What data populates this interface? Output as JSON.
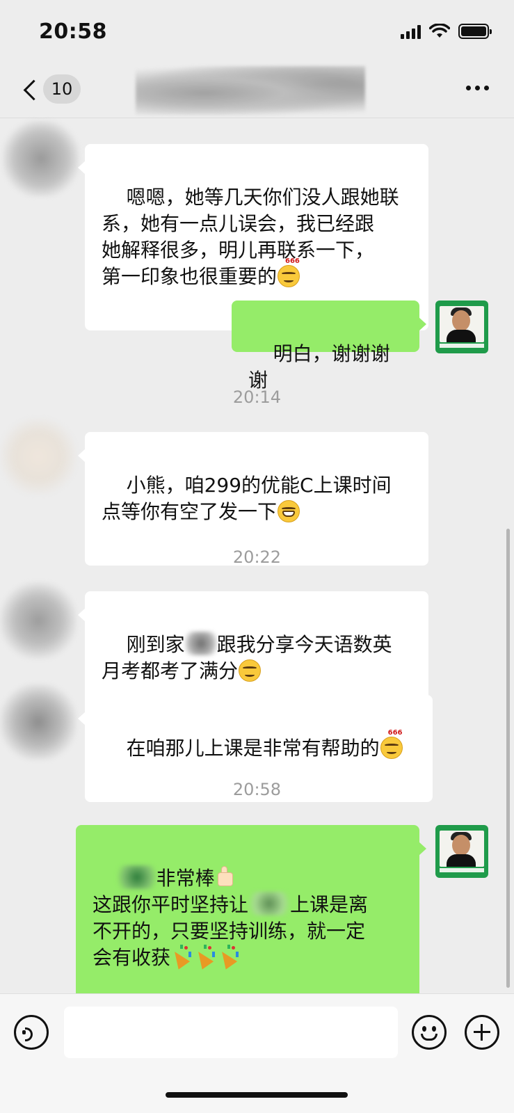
{
  "status_bar": {
    "time": "20:58"
  },
  "nav": {
    "unread_count": "10"
  },
  "messages": [
    {
      "type": "incoming",
      "text": "嗯嗯，她等几天你们没人跟她联\n系，她有一点儿误会，我已经跟\n她解释很多，明儿再联系一下，\n第一印象也很重要的",
      "emoji": "smirk-666-emoji"
    },
    {
      "type": "outgoing",
      "text": "明白，谢谢谢谢"
    },
    {
      "type": "time",
      "text": "20:14"
    },
    {
      "type": "incoming",
      "text": "小熊，咱299的优能C上课时间\n点等你有空了发一下",
      "emoji": "grin-emoji"
    },
    {
      "type": "time",
      "text": "20:22"
    },
    {
      "type": "incoming",
      "text_a": "刚到家",
      "text_b": "跟我分享今天语数英\n月考都考了满分",
      "emoji": "smirk-emoji"
    },
    {
      "type": "incoming",
      "text": "在咱那儿上课是非常有帮助的",
      "emoji": "smirk-666-emoji"
    },
    {
      "type": "time",
      "text": "20:58"
    },
    {
      "type": "outgoing",
      "text_a": "非常棒",
      "text_b": "这跟你平时坚持让",
      "text_c": "上课是离\n不开的，只要坚持训练，就一定\n会有收获",
      "emoji": "thumbs-up-emoji"
    }
  ],
  "emoji_text": {
    "sixes": "666"
  },
  "colors": {
    "background": "#ededed",
    "incoming_bubble": "#ffffff",
    "outgoing_bubble": "#95ec69",
    "timestamp": "#9c9c9c"
  }
}
